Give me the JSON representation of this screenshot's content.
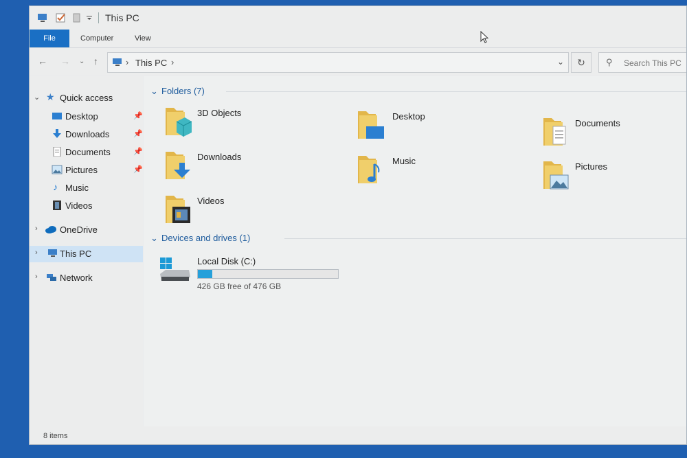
{
  "window": {
    "title": "This PC",
    "quick_access_icons": [
      "pc-icon",
      "properties-checkbox-icon",
      "new-folder-icon",
      "customize-dropdown-icon"
    ]
  },
  "ribbon": {
    "file_tab": "File",
    "tabs": [
      "Computer",
      "View"
    ]
  },
  "address_bar": {
    "path_label": "This PC",
    "icons": [
      "back-arrow-icon",
      "forward-arrow-icon",
      "recent-dropdown-icon",
      "up-arrow-icon",
      "refresh-icon"
    ]
  },
  "search": {
    "placeholder": "Search This PC"
  },
  "sidebar": {
    "quick_access": "Quick access",
    "pinned": [
      {
        "label": "Desktop",
        "pinned": true
      },
      {
        "label": "Downloads",
        "pinned": true
      },
      {
        "label": "Documents",
        "pinned": true
      },
      {
        "label": "Pictures",
        "pinned": true
      },
      {
        "label": "Music",
        "pinned": false
      },
      {
        "label": "Videos",
        "pinned": false
      }
    ],
    "onedrive": "OneDrive",
    "this_pc": "This PC",
    "network": "Network"
  },
  "content": {
    "folders_header": "Folders (7)",
    "folders": [
      {
        "name": "3D Objects",
        "icon": "3d-objects-icon"
      },
      {
        "name": "Desktop",
        "icon": "desktop-folder-icon"
      },
      {
        "name": "Documents",
        "icon": "documents-folder-icon"
      },
      {
        "name": "Downloads",
        "icon": "downloads-folder-icon"
      },
      {
        "name": "Music",
        "icon": "music-folder-icon"
      },
      {
        "name": "Pictures",
        "icon": "pictures-folder-icon"
      },
      {
        "name": "Videos",
        "icon": "videos-folder-icon"
      }
    ],
    "devices_header": "Devices and drives (1)",
    "drive": {
      "name": "Local Disk (C:)",
      "free_text": "426 GB free of 476 GB",
      "used_fraction": 0.105
    }
  },
  "status": {
    "items": "8 items"
  },
  "colors": {
    "accent": "#1a6fc4",
    "selection": "#cfe3f5",
    "folder": "#e8c25c",
    "drive_bar": "#26a0da"
  }
}
